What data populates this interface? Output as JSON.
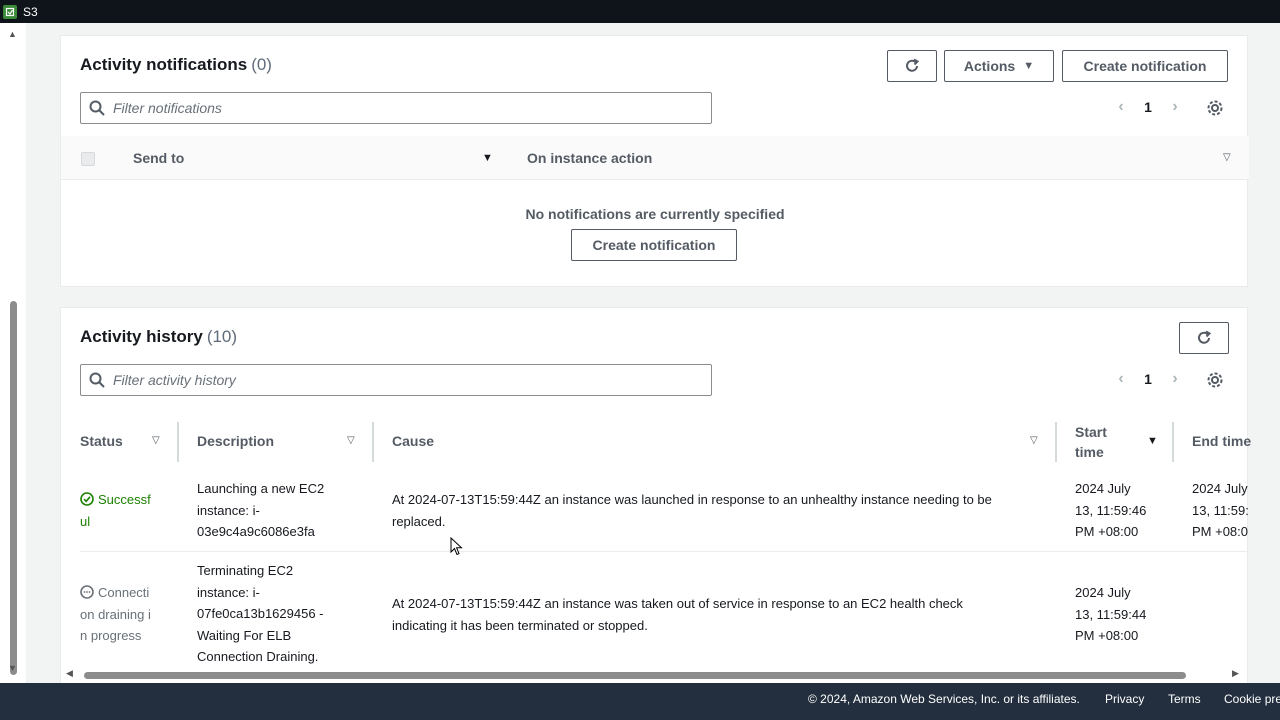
{
  "window": {
    "app_title": "S3"
  },
  "notifications": {
    "title": "Activity notifications",
    "count": "(0)",
    "actions_label": "Actions",
    "create_label": "Create notification",
    "filter_placeholder": "Filter notifications",
    "page": "1",
    "columns": {
      "send_to": "Send to",
      "on_instance_action": "On instance action"
    },
    "empty_message": "No notifications are currently specified",
    "empty_create_label": "Create notification"
  },
  "history": {
    "title": "Activity history",
    "count": "(10)",
    "filter_placeholder": "Filter activity history",
    "page": "1",
    "columns": {
      "status": "Status",
      "description": "Description",
      "cause": "Cause",
      "start_time_1": "Start",
      "start_time_2": "time",
      "end_time": "End time"
    },
    "rows": [
      {
        "status_1": "Successf",
        "status_2": "ul",
        "desc_1": "Launching a new EC2",
        "desc_2": "instance: i-",
        "desc_3": "03e9c4a9c6086e3fa",
        "cause_1": "At 2024-07-13T15:59:44Z an instance was launched in response to an unhealthy instance needing to be",
        "cause_2": "replaced.",
        "start_1": "2024 July",
        "start_2": "13, 11:59:46",
        "start_3": "PM +08:00",
        "end_1": "2024 July",
        "end_2": "13, 11:59:",
        "end_3": "PM +08:0"
      },
      {
        "status_1": "Connecti",
        "status_2": "on draining i",
        "status_3": "n progress",
        "desc_1": "Terminating EC2",
        "desc_2": "instance: i-",
        "desc_3": "07fe0ca13b1629456 -",
        "desc_4": "Waiting For ELB",
        "desc_5": "Connection Draining.",
        "cause_1": "At 2024-07-13T15:59:44Z an instance was taken out of service in response to an EC2 health check",
        "cause_2": "indicating it has been terminated or stopped.",
        "start_1": "2024 July",
        "start_2": "13, 11:59:44",
        "start_3": "PM +08:00"
      }
    ]
  },
  "footer": {
    "copyright": "© 2024, Amazon Web Services, Inc. or its affiliates.",
    "privacy": "Privacy",
    "terms": "Terms",
    "cookie": "Cookie pre"
  },
  "colors": {
    "success": "#1d8102",
    "footer_bg": "#232f3e",
    "topbar_bg": "#0f141a"
  },
  "icons": [
    "app-icon",
    "refresh-icon",
    "caret-down-icon",
    "search-icon",
    "chevron-left-icon",
    "chevron-right-icon",
    "gear-icon",
    "success-check-icon",
    "pending-icon",
    "cursor-icon"
  ]
}
